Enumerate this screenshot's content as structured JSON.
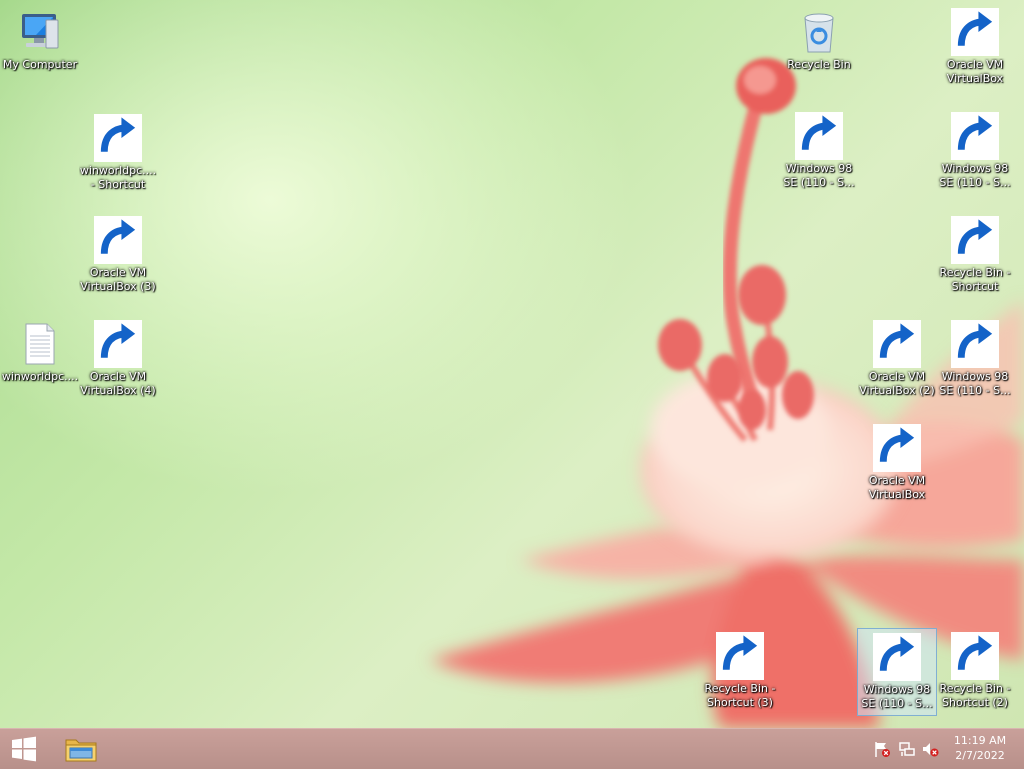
{
  "desktop": {
    "icons": [
      {
        "type": "computer",
        "label": "My Computer",
        "shortcut": false,
        "selected": false
      },
      {
        "type": "recycle",
        "label": "Recycle Bin",
        "shortcut": false,
        "selected": false
      },
      {
        "type": "vbox",
        "label": "Oracle VM\nVirtualBox",
        "shortcut": true,
        "selected": false
      },
      {
        "type": "doc",
        "label": "winworldpc....\n- Shortcut",
        "shortcut": true,
        "selected": false
      },
      {
        "type": "doc-green",
        "label": "Windows 98\nSE (110 - S...",
        "shortcut": true,
        "selected": false
      },
      {
        "type": "doc-green",
        "label": "Windows 98\nSE (110 - S...",
        "shortcut": true,
        "selected": false
      },
      {
        "type": "vbox",
        "label": "Oracle VM\nVirtualBox (3)",
        "shortcut": true,
        "selected": false
      },
      {
        "type": "recycle",
        "label": "Recycle Bin -\nShortcut",
        "shortcut": true,
        "selected": false
      },
      {
        "type": "doc",
        "label": "winworldpc....",
        "shortcut": false,
        "selected": false
      },
      {
        "type": "vbox",
        "label": "Oracle VM\nVirtualBox (4)",
        "shortcut": true,
        "selected": false
      },
      {
        "type": "vbox",
        "label": "Oracle VM\nVirtualBox (2)",
        "shortcut": true,
        "selected": false
      },
      {
        "type": "doc-green",
        "label": "Windows 98\nSE (110 - S...",
        "shortcut": true,
        "selected": false
      },
      {
        "type": "vbox",
        "label": "Oracle VM\nVirtualBox",
        "shortcut": true,
        "selected": false
      },
      {
        "type": "recycle",
        "label": "Recycle Bin -\nShortcut (3)",
        "shortcut": true,
        "selected": false
      },
      {
        "type": "doc-green",
        "label": "Windows 98\nSE (110 - S...",
        "shortcut": true,
        "selected": true
      },
      {
        "type": "recycle",
        "label": "Recycle Bin -\nShortcut (2)",
        "shortcut": true,
        "selected": false
      }
    ]
  },
  "taskbar": {
    "start_icon": "windows-logo-icon",
    "pinned": [
      {
        "icon": "file-explorer-icon"
      }
    ],
    "tray": [
      {
        "icon": "action-center-flag-icon"
      },
      {
        "icon": "network-icon"
      },
      {
        "icon": "volume-muted-icon"
      }
    ],
    "clock": {
      "time": "11:19 AM",
      "date": "2/7/2022"
    }
  },
  "colors": {
    "taskbar": "#b8908a",
    "desktop_green": "#c4e8a8",
    "flower": "#f28078",
    "selection": "#cde6f7"
  }
}
